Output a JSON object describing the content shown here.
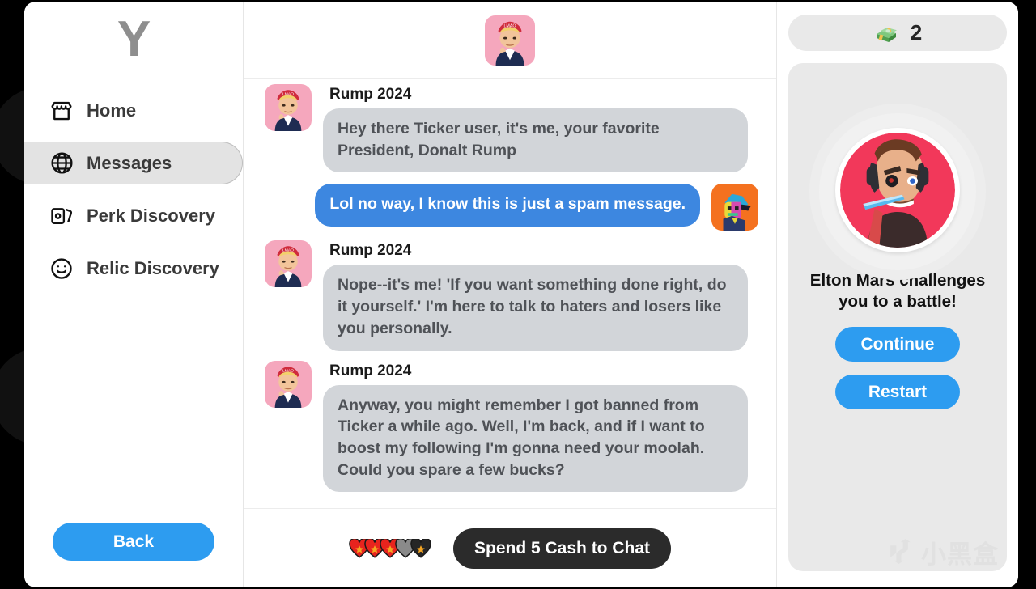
{
  "app": {
    "brand": "Y",
    "back_label": "Back"
  },
  "sidebar": {
    "items": [
      {
        "label": "Home",
        "icon": "store-icon",
        "active": false
      },
      {
        "label": "Messages",
        "icon": "globe-icon",
        "active": true
      },
      {
        "label": "Perk Discovery",
        "icon": "cards-icon",
        "active": false
      },
      {
        "label": "Relic Discovery",
        "icon": "smiley-icon",
        "active": false
      }
    ]
  },
  "chat": {
    "header_avatar": "rump-avatar-icon",
    "messages": [
      {
        "sender": "Rump 2024",
        "side": "in",
        "avatar": "rump-avatar-icon",
        "text": "Hey there Ticker user, it's me, your favorite President, Donalt Rump"
      },
      {
        "sender": "",
        "side": "out",
        "avatar": "player-avatar-icon",
        "text": "Lol no way, I know this is just a spam message."
      },
      {
        "sender": "Rump 2024",
        "side": "in",
        "avatar": "rump-avatar-icon",
        "text": "Nope--it's me! 'If you want something done right, do it yourself.' I'm here to talk to haters and losers like you personally."
      },
      {
        "sender": "Rump 2024",
        "side": "in",
        "avatar": "rump-avatar-icon",
        "text": "Anyway, you might remember I got banned from Ticker a while ago. Well, I'm back, and if I want to boost my following I'm gonna need your moolah. Could you spare a few bucks?"
      }
    ],
    "footer": {
      "hearts": [
        "red",
        "red",
        "red",
        "gray",
        "black"
      ],
      "spend_label": "Spend 5 Cash to Chat"
    }
  },
  "right_panel": {
    "cash": {
      "icon": "money-stack-icon",
      "amount": "2"
    },
    "event": {
      "portrait": "elton-mars-avatar-icon",
      "headline": "Elton Mars challenges you to a battle!",
      "continue_label": "Continue",
      "restart_label": "Restart"
    }
  },
  "watermark": {
    "text": "小黑盒",
    "icon": "xiaoheihe-logo-icon"
  },
  "colors": {
    "accent_blue": "#2d9cf0",
    "bubble_out": "#3d87e0",
    "bubble_in": "#d2d5d9",
    "panel_gray": "#e9e9e9",
    "spend_dark": "#2b2b2b"
  }
}
